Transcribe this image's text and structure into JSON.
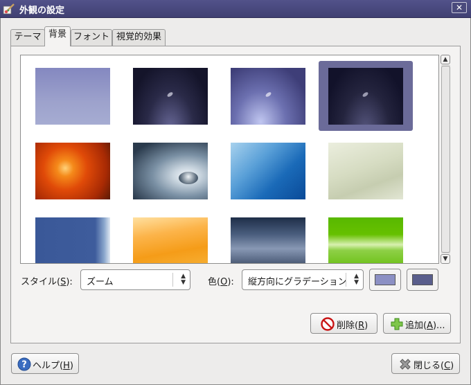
{
  "window": {
    "title": "外観の設定",
    "close_label": "✕"
  },
  "tabs": [
    {
      "label": "テーマ",
      "active": false
    },
    {
      "label": "背景",
      "active": true
    },
    {
      "label": "フォント",
      "active": false
    },
    {
      "label": "視覚的効果",
      "active": false
    }
  ],
  "backgrounds": [
    {
      "name": "blue-gradient",
      "selected": false
    },
    {
      "name": "dark-night-feather",
      "selected": false
    },
    {
      "name": "purple-glow-feather",
      "selected": false
    },
    {
      "name": "dark-feather-selected",
      "selected": true
    },
    {
      "name": "orange-flower",
      "selected": false
    },
    {
      "name": "water-drop",
      "selected": false
    },
    {
      "name": "blue-waves",
      "selected": false
    },
    {
      "name": "sand-texture",
      "selected": false
    },
    {
      "name": "blue-abstract",
      "selected": false
    },
    {
      "name": "orange-waves",
      "selected": false
    },
    {
      "name": "stormy-sky",
      "selected": false
    },
    {
      "name": "green-waves",
      "selected": false
    }
  ],
  "style": {
    "label_prefix": "スタイル(",
    "label_key": "S",
    "label_suffix": "):",
    "value": "ズーム"
  },
  "color": {
    "label_prefix": "色(",
    "label_key": "O",
    "label_suffix": "):",
    "value": "縦方向にグラデーション",
    "primary": "#8c90c4",
    "secondary": "#5a5e8c"
  },
  "buttons": {
    "remove": {
      "prefix": "削除(",
      "key": "R",
      "suffix": ")"
    },
    "add": {
      "prefix": "追加(",
      "key": "A",
      "suffix": ")..."
    },
    "help": {
      "prefix": "ヘルプ(",
      "key": "H",
      "suffix": ")"
    },
    "close": {
      "prefix": "閉じる(",
      "key": "C",
      "suffix": ")"
    }
  }
}
